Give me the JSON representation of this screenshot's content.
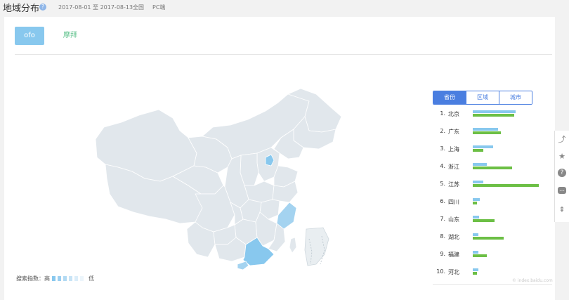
{
  "header": {
    "title": "地域分布",
    "help_icon": "question-circle-icon",
    "date_range": "2017-08-01 至 2017-08-13",
    "region": "全国",
    "device": "PC端"
  },
  "tabs": [
    {
      "label": "ofo",
      "active": true
    },
    {
      "label": "摩拜",
      "active": false
    }
  ],
  "legend": {
    "label": "搜索指数：高",
    "low_label": "低",
    "colors": [
      "#88c8ee",
      "#9ccff0",
      "#b2daf3",
      "#c8e4f6",
      "#dbedf9",
      "#ecf5fb"
    ]
  },
  "segmented": [
    {
      "label": "省份",
      "active": true
    },
    {
      "label": "区域",
      "active": false
    },
    {
      "label": "城市",
      "active": false
    }
  ],
  "ranking": [
    {
      "rank": "1.",
      "name": "北京",
      "ofo": 0.64,
      "mobike": 0.61
    },
    {
      "rank": "2.",
      "name": "广东",
      "ofo": 0.37,
      "mobike": 0.42
    },
    {
      "rank": "3.",
      "name": "上海",
      "ofo": 0.3,
      "mobike": 0.16
    },
    {
      "rank": "4.",
      "name": "浙江",
      "ofo": 0.21,
      "mobike": 0.58
    },
    {
      "rank": "5.",
      "name": "江苏",
      "ofo": 0.16,
      "mobike": 0.98
    },
    {
      "rank": "6.",
      "name": "四川",
      "ofo": 0.1,
      "mobike": 0.06
    },
    {
      "rank": "7.",
      "name": "山东",
      "ofo": 0.09,
      "mobike": 0.32
    },
    {
      "rank": "8.",
      "name": "湖北",
      "ofo": 0.08,
      "mobike": 0.46
    },
    {
      "rank": "9.",
      "name": "福建",
      "ofo": 0.08,
      "mobike": 0.21
    },
    {
      "rank": "10.",
      "name": "河北",
      "ofo": 0.08,
      "mobike": 0.06
    }
  ],
  "bar_colors": {
    "ofo": "#88c8ee",
    "mobike": "#6cbf45"
  },
  "watermark": "© index.baidu.com",
  "side_tools": [
    "share-icon",
    "star-icon",
    "help-icon",
    "comment-icon",
    "back-to-top-icon"
  ]
}
